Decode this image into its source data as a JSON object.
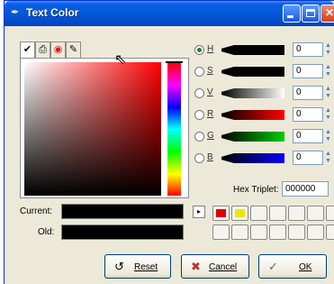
{
  "window": {
    "title": "Text Color",
    "title_icon": "✒",
    "minimize_icon": "",
    "maximize_icon": "",
    "close_icon": "✕"
  },
  "tabs": [
    {
      "icon": "color-picker-icon",
      "glyph": "✔"
    },
    {
      "icon": "printer-icon",
      "glyph": "⎙"
    },
    {
      "icon": "watercolor-icon",
      "glyph": "◉"
    },
    {
      "icon": "brush-icon",
      "glyph": "✎"
    }
  ],
  "channels": [
    {
      "label": "H",
      "value": "0",
      "checked": true,
      "bar_from": "#000000",
      "bar_to": "#000000"
    },
    {
      "label": "S",
      "value": "0",
      "checked": false,
      "bar_from": "#000000",
      "bar_to": "#000000"
    },
    {
      "label": "V",
      "value": "0",
      "checked": false,
      "bar_from": "#000000",
      "bar_to": "#ffffff"
    },
    {
      "label": "R",
      "value": "0",
      "checked": false,
      "bar_from": "#000000",
      "bar_to": "#ff0000"
    },
    {
      "label": "G",
      "value": "0",
      "checked": false,
      "bar_from": "#000000",
      "bar_to": "#00cc00"
    },
    {
      "label": "B",
      "value": "0",
      "checked": false,
      "bar_from": "#000000",
      "bar_to": "#0000ff"
    }
  ],
  "hex": {
    "label": "Hex Triplet:",
    "value": "000000"
  },
  "current_label": "Current:",
  "old_label": "Old:",
  "current_color": "#000000",
  "old_color": "#000000",
  "palette": {
    "arrow": "▸",
    "row1": [
      "#e00000",
      "#e8e800",
      "",
      "",
      "",
      "",
      ""
    ],
    "row2": [
      "",
      "",
      "",
      "",
      "",
      "",
      ""
    ]
  },
  "buttons": {
    "reset": {
      "label": "Reset",
      "glyph": "↺"
    },
    "cancel": {
      "label": "Cancel",
      "glyph": "✖"
    },
    "ok": {
      "label": "OK",
      "glyph": "✓"
    }
  }
}
